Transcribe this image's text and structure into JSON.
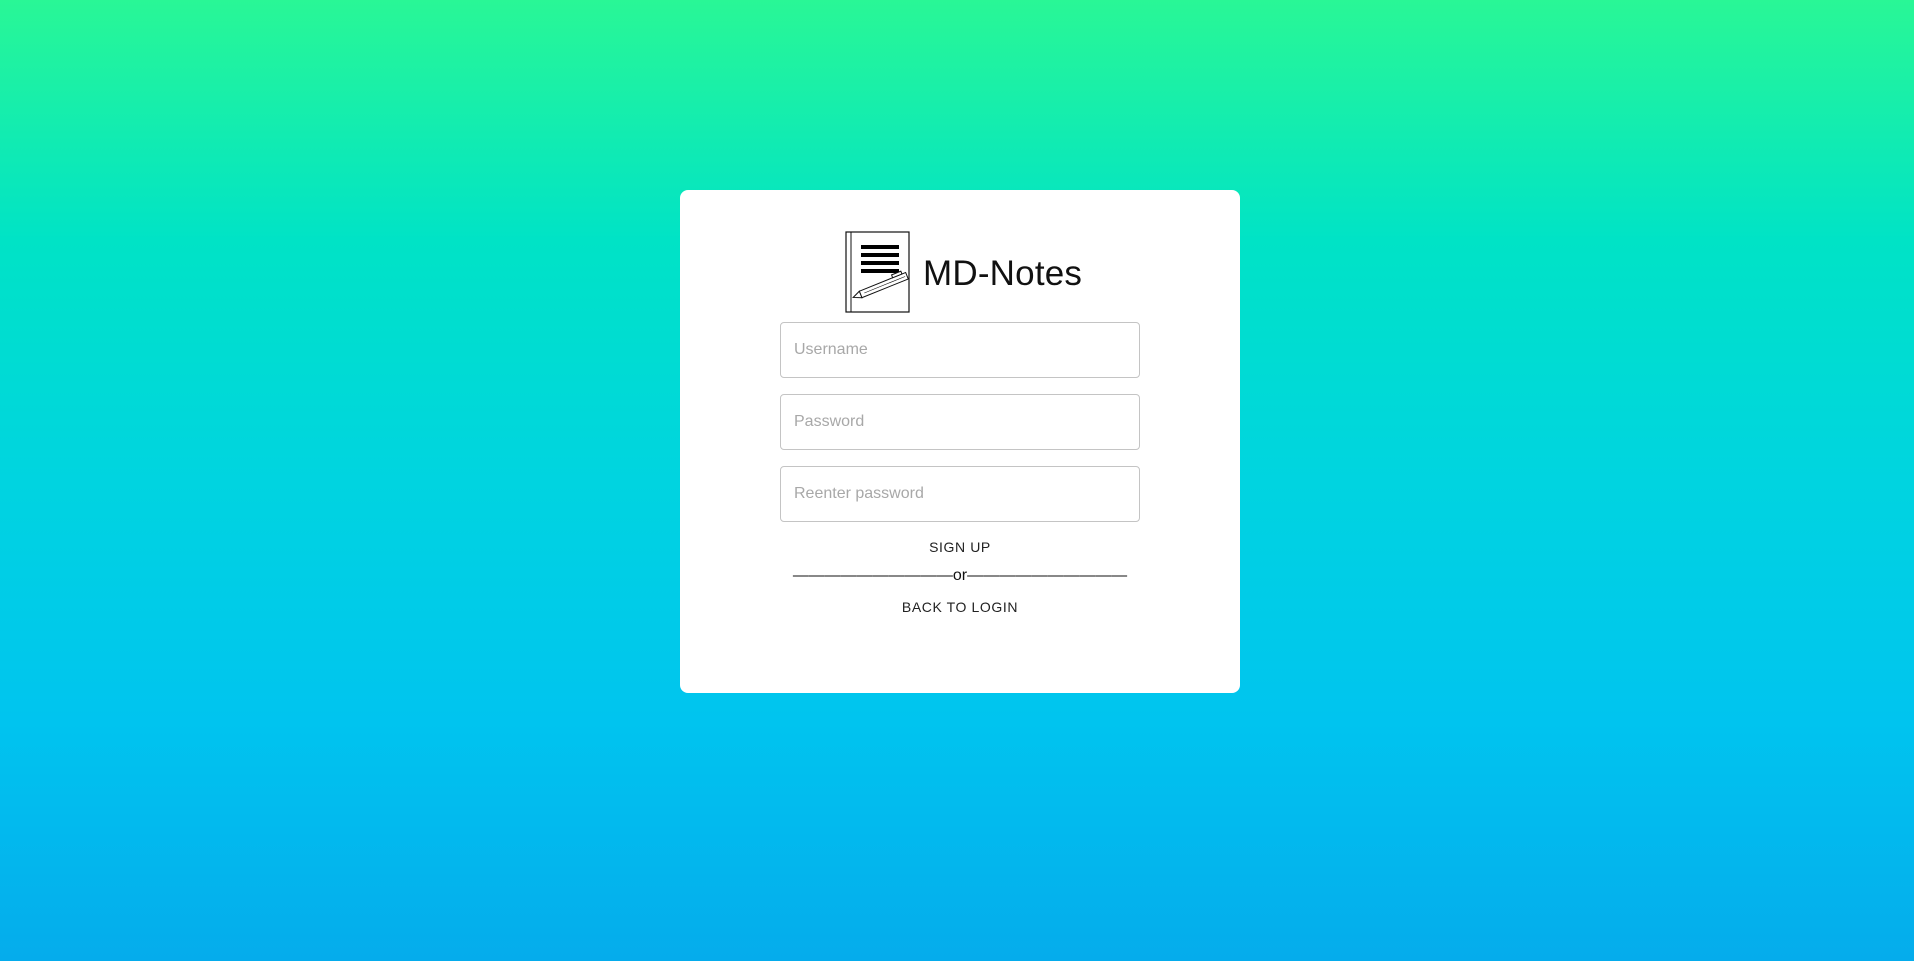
{
  "app": {
    "title": "MD-Notes",
    "logo_icon": "notebook-pen-icon"
  },
  "form": {
    "username_placeholder": "Username",
    "password_placeholder": "Password",
    "reenter_placeholder": "Reenter password",
    "signup_label": "SIGN UP",
    "divider_text": "——————————or——————————",
    "back_label": "BACK TO LOGIN"
  },
  "colors": {
    "gradient_top": "#29f796",
    "gradient_bottom": "#05acec",
    "card": "#ffffff"
  }
}
